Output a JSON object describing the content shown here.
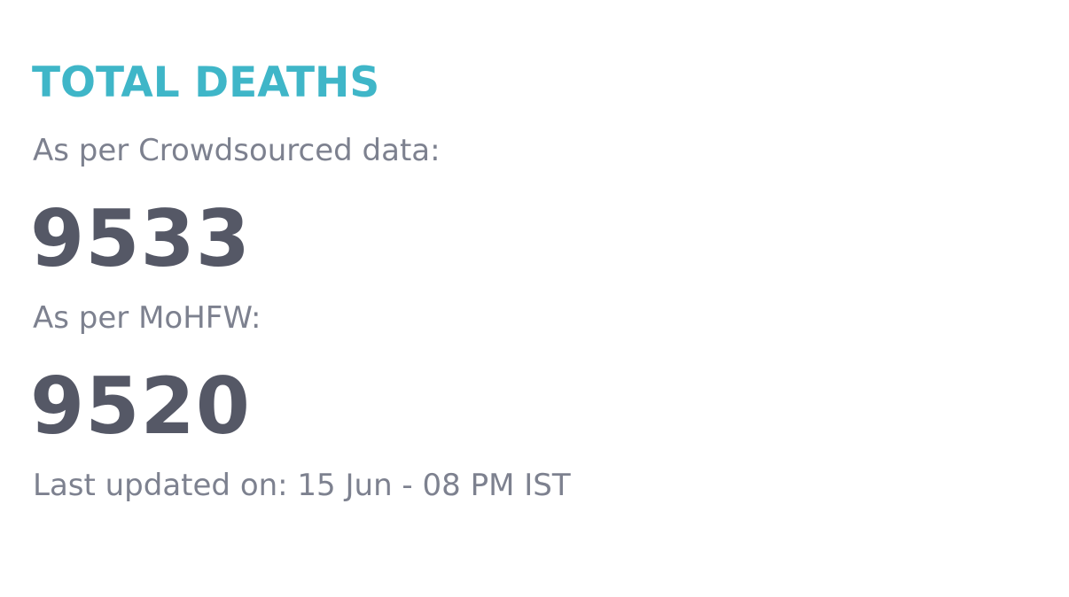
{
  "card": {
    "title": "TOTAL DEATHS",
    "crowdsourced_label": "As per Crowdsourced data:",
    "crowdsourced_value": "9533",
    "mohfw_label": "As per MoHFW:",
    "mohfw_value": "9520",
    "last_updated": "Last updated on: 15 Jun - 08 PM IST"
  },
  "colors": {
    "title": "#3fb6c8",
    "value": "#555866",
    "label": "#7d818f",
    "background": "#ffffff"
  }
}
